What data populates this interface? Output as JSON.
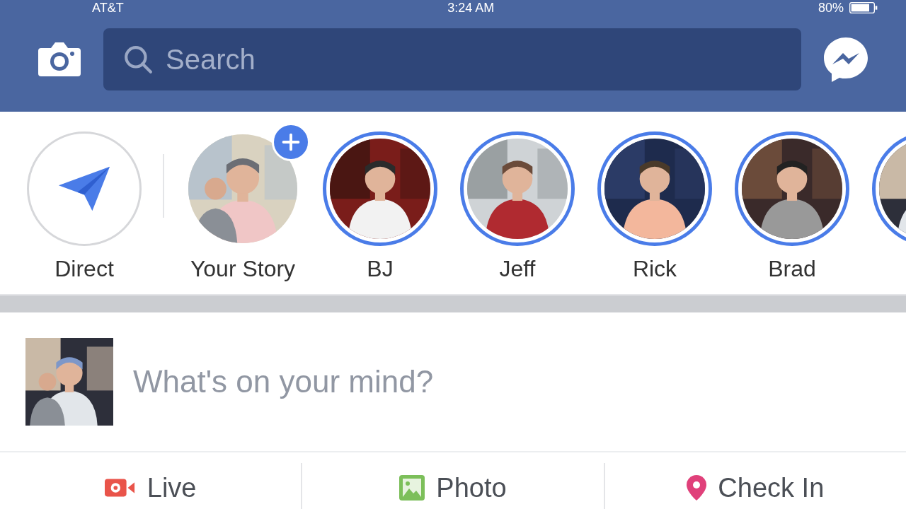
{
  "status_bar": {
    "carrier": "AT&T",
    "time": "3:24 AM",
    "battery": "80%"
  },
  "header": {
    "search": {
      "placeholder": "Search"
    }
  },
  "stories": [
    {
      "kind": "direct",
      "name": "Direct"
    },
    {
      "kind": "own",
      "name": "Your Story"
    },
    {
      "kind": "friend",
      "name": "BJ",
      "unseen": true
    },
    {
      "kind": "friend",
      "name": "Jeff",
      "unseen": true
    },
    {
      "kind": "friend",
      "name": "Rick",
      "unseen": true
    },
    {
      "kind": "friend",
      "name": "Brad",
      "unseen": true
    },
    {
      "kind": "friend",
      "unseen": true
    }
  ],
  "composer": {
    "placeholder": "What's on your mind?"
  },
  "actions": [
    {
      "kind": "live",
      "label": "Live"
    },
    {
      "label": "Photo"
    },
    {
      "kind": "checkin",
      "label": "Check In"
    }
  ]
}
